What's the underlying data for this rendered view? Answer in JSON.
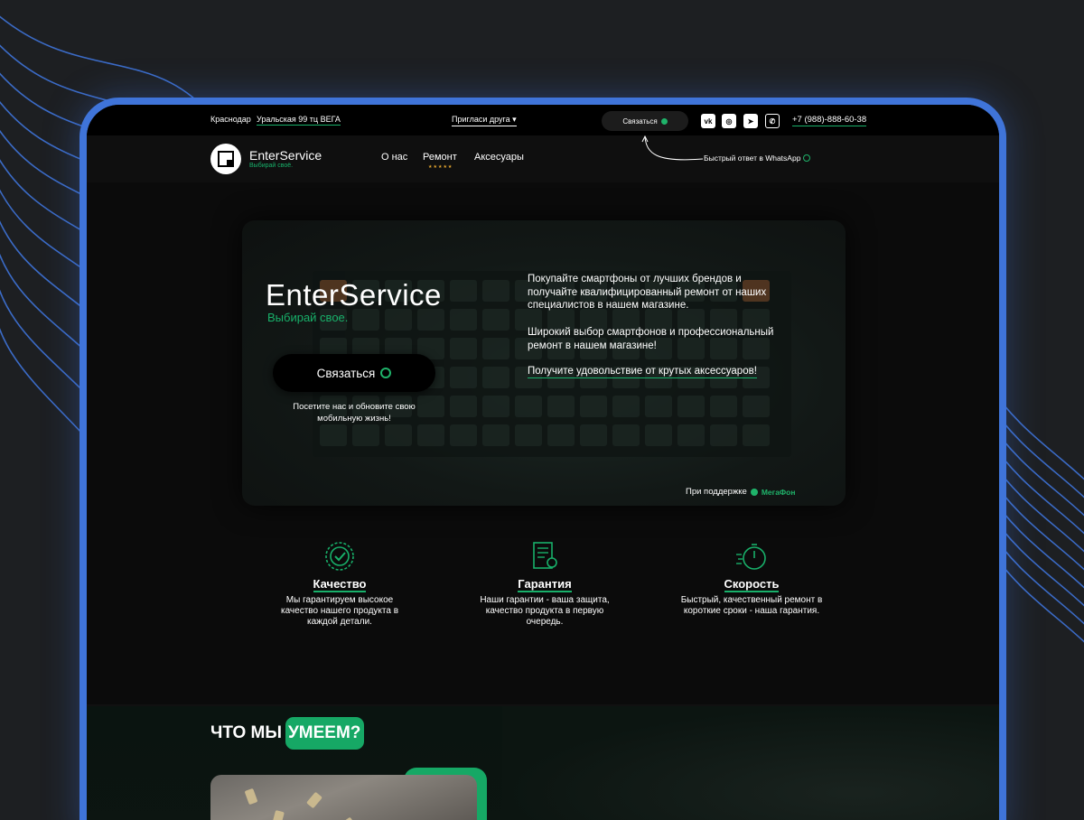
{
  "topbar": {
    "city": "Краснодар",
    "address": "Уральская 99 тц ВЕГА",
    "invite": "Пригласи друга ▾",
    "contact_button": "Связаться",
    "socials": [
      {
        "icon": "vk-icon",
        "glyph": "vk"
      },
      {
        "icon": "instagram-icon",
        "glyph": "◎"
      },
      {
        "icon": "telegram-icon",
        "glyph": "➤"
      },
      {
        "icon": "whatsapp-icon",
        "glyph": "✆"
      }
    ],
    "phone": "+7 (988)-888-60-38"
  },
  "header": {
    "brand_name": "EnterService",
    "brand_tagline": "Выбирай своё.",
    "nav": [
      "О нас",
      "Ремонт",
      "Аксесуары"
    ],
    "repair_stars": "★★★★★",
    "whatsapp_hint": "Быстрый ответ в WhatsApp"
  },
  "hero": {
    "title": "EnterService",
    "subtitle": "Выбирай свое.",
    "button_label": "Связаться",
    "note": "Посетите нас и обновите свою мобильную жизнь!",
    "paragraph1": "Покупайте смартфоны от лучших брендов и получайте квалифицированный ремонт от наших специалистов в нашем магазине.",
    "paragraph2": "Широкий выбор смартфонов и профессиональный ремонт в нашем магазине!",
    "link": "Получите удовольствие от крутых аксессуаров!",
    "support_label": "При поддержке",
    "support_brand": "МегаФон"
  },
  "features": [
    {
      "icon": "quality-badge-icon",
      "title": "Качество",
      "text": "Мы гарантируем высокое качество нашего продукта в каждой детали."
    },
    {
      "icon": "guarantee-certificate-icon",
      "title": "Гарантия",
      "text": "Наши гарантии - ваша защита, качество продукта в первую очередь."
    },
    {
      "icon": "speed-stopwatch-icon",
      "title": "Скорость",
      "text": "Быстрый, качественный ремонт в короткие сроки - наша гарантия."
    }
  ],
  "section2": {
    "title_prefix": "ЧТО МЫ",
    "title_highlight": "УМЕЕМ?"
  },
  "colors": {
    "accent": "#18b06a",
    "frame": "#3f74d9",
    "background": "#0b0b0b",
    "stars": "#e4a52f"
  }
}
